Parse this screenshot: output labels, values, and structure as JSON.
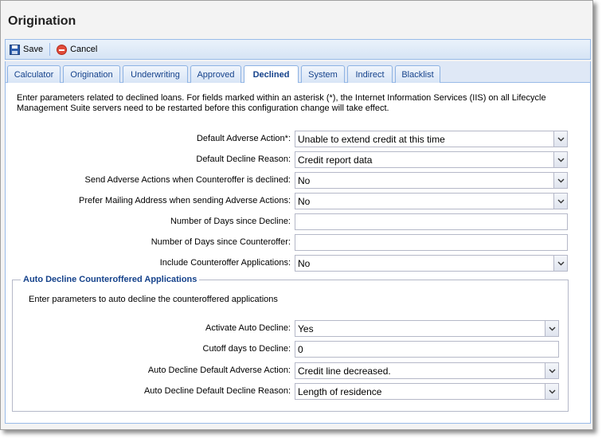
{
  "window": {
    "title": "Origination"
  },
  "toolbar": {
    "save_label": "Save",
    "cancel_label": "Cancel"
  },
  "tabs": [
    {
      "label": "Calculator"
    },
    {
      "label": "Origination"
    },
    {
      "label": "Underwriting"
    },
    {
      "label": "Approved"
    },
    {
      "label": "Declined",
      "active": true
    },
    {
      "label": "System"
    },
    {
      "label": "Indirect"
    },
    {
      "label": "Blacklist"
    }
  ],
  "intro": "Enter parameters related to declined loans. For fields marked within an asterisk (*), the Internet Information Services (IIS) on all Lifecycle Management Suite servers need to be restarted before this configuration change will take effect.",
  "fields": [
    {
      "label": "Default Adverse Action*:",
      "value": "Unable to extend credit at this time",
      "type": "select"
    },
    {
      "label": "Default Decline Reason:",
      "value": "Credit report data",
      "type": "select"
    },
    {
      "label": "Send Adverse Actions when Counteroffer is declined:",
      "value": "No",
      "type": "select"
    },
    {
      "label": "Prefer Mailing Address when sending Adverse Actions:",
      "value": "No",
      "type": "select"
    },
    {
      "label": "Number of Days since Decline:",
      "value": "",
      "type": "text"
    },
    {
      "label": "Number of Days since Counteroffer:",
      "value": "",
      "type": "text"
    },
    {
      "label": "Include Counteroffer Applications:",
      "value": "No",
      "type": "select"
    }
  ],
  "auto_decline": {
    "legend": "Auto Decline Counteroffered Applications",
    "intro": "Enter parameters to auto decline the counteroffered applications",
    "fields": [
      {
        "label": "Activate Auto Decline:",
        "value": "Yes",
        "type": "select"
      },
      {
        "label": "Cutoff days to Decline:",
        "value": "0",
        "type": "text"
      },
      {
        "label": "Auto Decline Default Adverse Action:",
        "value": "Credit line decreased.",
        "type": "select"
      },
      {
        "label": "Auto Decline Default Decline Reason:",
        "value": "Length of residence",
        "type": "select"
      }
    ]
  },
  "colors": {
    "accent": "#15428b",
    "toolbar_border": "#99bbe8",
    "cancel": "#e04b3a"
  },
  "icons": {
    "save": "floppy-disk-icon",
    "cancel": "cancel-circle-icon",
    "dropdown": "chevron-down-icon"
  }
}
